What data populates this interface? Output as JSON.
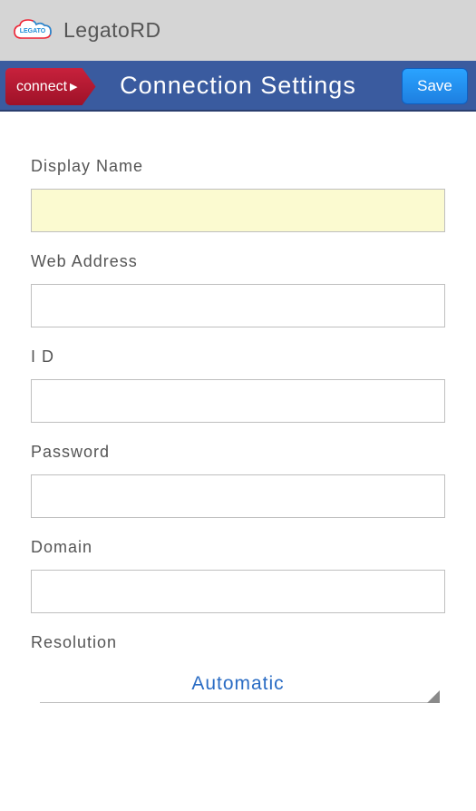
{
  "app": {
    "title": "LegatoRD",
    "logo_text": "LEGATO"
  },
  "header": {
    "connect_label": "connect",
    "title": "Connection Settings",
    "save_label": "Save"
  },
  "form": {
    "display_name": {
      "label": "Display Name",
      "value": ""
    },
    "web_address": {
      "label": "Web Address",
      "value": ""
    },
    "id": {
      "label": "I D",
      "value": ""
    },
    "password": {
      "label": "Password",
      "value": ""
    },
    "domain": {
      "label": "Domain",
      "value": ""
    },
    "resolution": {
      "label": "Resolution",
      "value": "Automatic"
    }
  },
  "colors": {
    "header": "#3a5b9f",
    "connect": "#b41a31",
    "save": "#1f8af0",
    "link": "#2a6cc4"
  }
}
